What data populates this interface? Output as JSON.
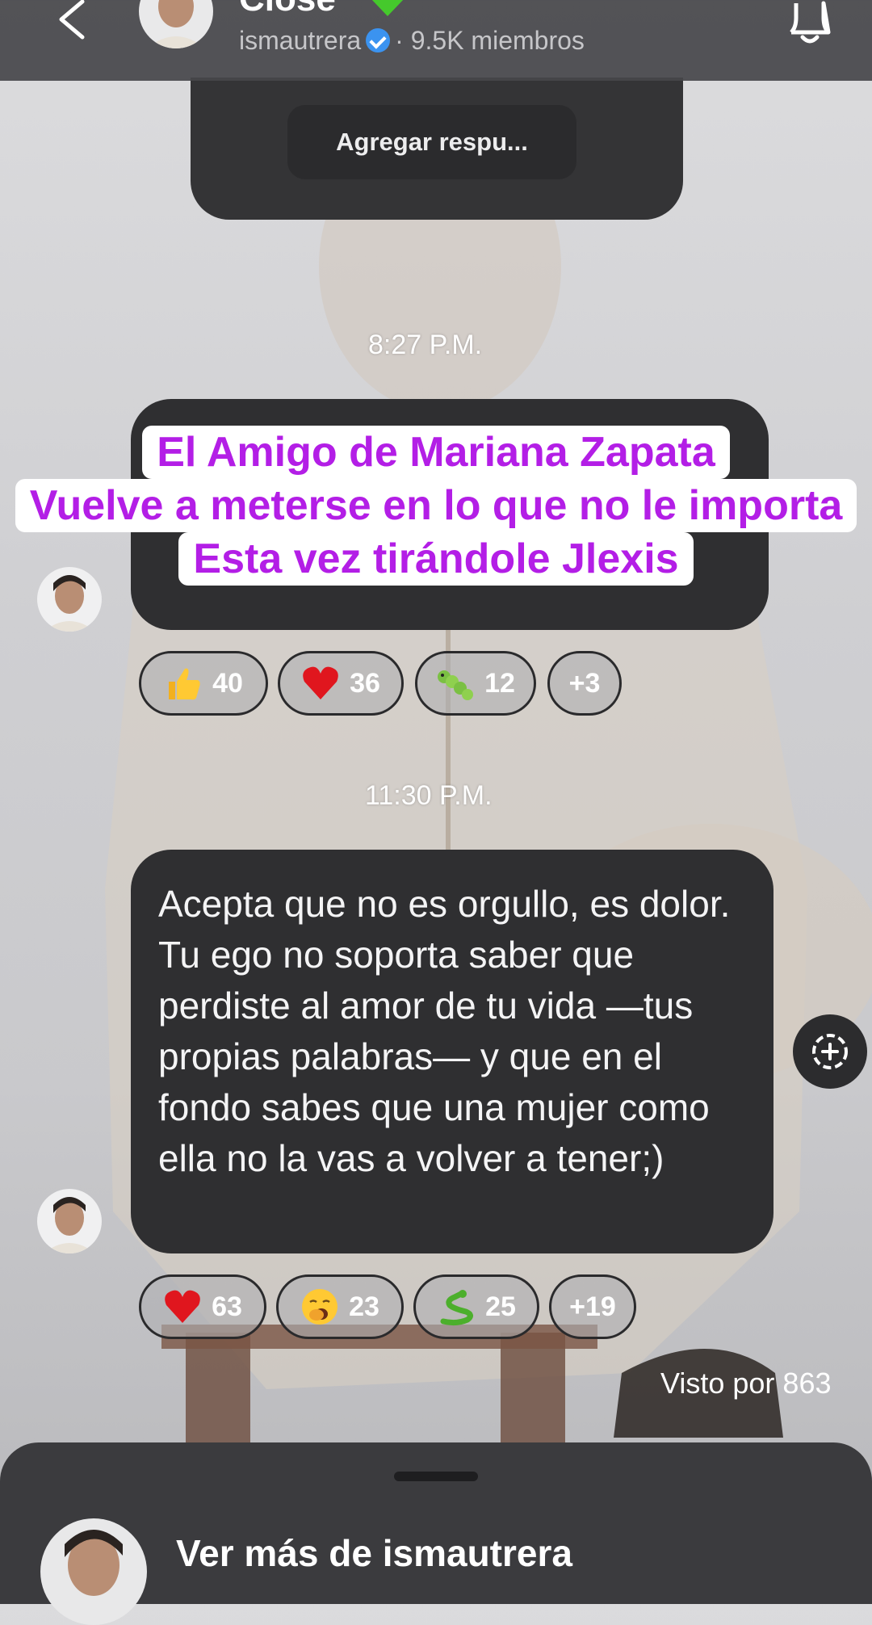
{
  "header": {
    "title": "Close",
    "username": "ismautrera",
    "members": "· 9.5K miembros"
  },
  "reply": {
    "button_label": "Agregar respu..."
  },
  "messages": [
    {
      "time": "8:27 P.M.",
      "reactions": [
        {
          "emoji": "thumbs-up",
          "count": "40"
        },
        {
          "emoji": "red-heart",
          "count": "36"
        },
        {
          "emoji": "caterpillar",
          "count": "12"
        },
        {
          "emoji": "",
          "count": "+3"
        }
      ]
    },
    {
      "time": "11:30 P.M.",
      "text": "Acepta que no es orgullo, es dolor. Tu ego no soporta saber que perdiste al amor de tu vida —tus propias palabras— y que en el fondo sabes que una mujer como ella no la vas a volver a tener;)",
      "reactions": [
        {
          "emoji": "red-heart",
          "count": "63"
        },
        {
          "emoji": "yawning-face",
          "count": "23"
        },
        {
          "emoji": "snake",
          "count": "25"
        },
        {
          "emoji": "",
          "count": "+19"
        }
      ]
    }
  ],
  "caption": {
    "lines": [
      "El Amigo de Mariana Zapata",
      "Vuelve a meterse en lo que no le importa",
      "Esta vez tirándole Jlexis"
    ],
    "color": "#b31ee6"
  },
  "seen": "Visto por 863",
  "sheet": {
    "text": "Ver más de ismautrera"
  }
}
